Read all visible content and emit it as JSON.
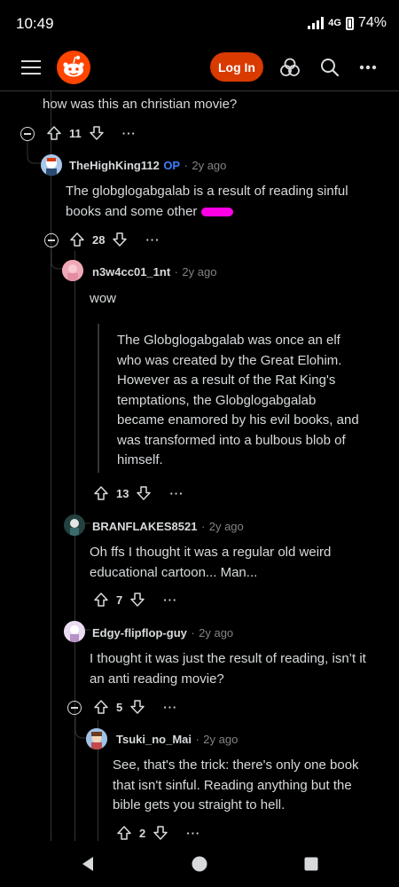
{
  "status_bar": {
    "time": "10:49",
    "network": "4G",
    "battery": "74%"
  },
  "header": {
    "login_label": "Log In"
  },
  "comments": [
    {
      "text": "how was this an christian movie?",
      "votes": "11"
    },
    {
      "user": "TheHighKing112",
      "op_label": "OP",
      "age": "2y ago",
      "text_line1": "The globglogabgalab is a result of reading sinful",
      "text_line2": "books and some other",
      "votes": "28"
    },
    {
      "user": "n3w4cc01_1nt",
      "age": "2y ago",
      "text": "wow",
      "quote": [
        "The Globglogabgalab was once an elf",
        "who was created by the Great Elohim.",
        "However as a result of the Rat King's",
        "temptations, the Globglogabgalab",
        "became enamored by his evil books, and",
        "was transformed into a bulbous blob of",
        "himself."
      ],
      "votes": "13"
    },
    {
      "user": "BRANFLAKES8521",
      "age": "2y ago",
      "text": [
        "Oh ffs I thought it was a regular old weird",
        "educational cartoon... Man..."
      ],
      "votes": "7"
    },
    {
      "user": "Edgy-flipflop-guy",
      "age": "2y ago",
      "text": [
        "I thought it was just the result of reading, isn’t it",
        "an anti reading movie?"
      ],
      "votes": "5"
    },
    {
      "user": "Tsuki_no_Mai",
      "age": "2y ago",
      "text": [
        "See, that's the trick: there's only one book",
        "that isn't sinful. Reading anything but the",
        "bible gets you straight to hell."
      ],
      "votes": "2"
    }
  ],
  "colors": {
    "background": "#000000",
    "accent": "#d93a00",
    "op": "#3d7fff",
    "redact": "#ff00e6"
  }
}
